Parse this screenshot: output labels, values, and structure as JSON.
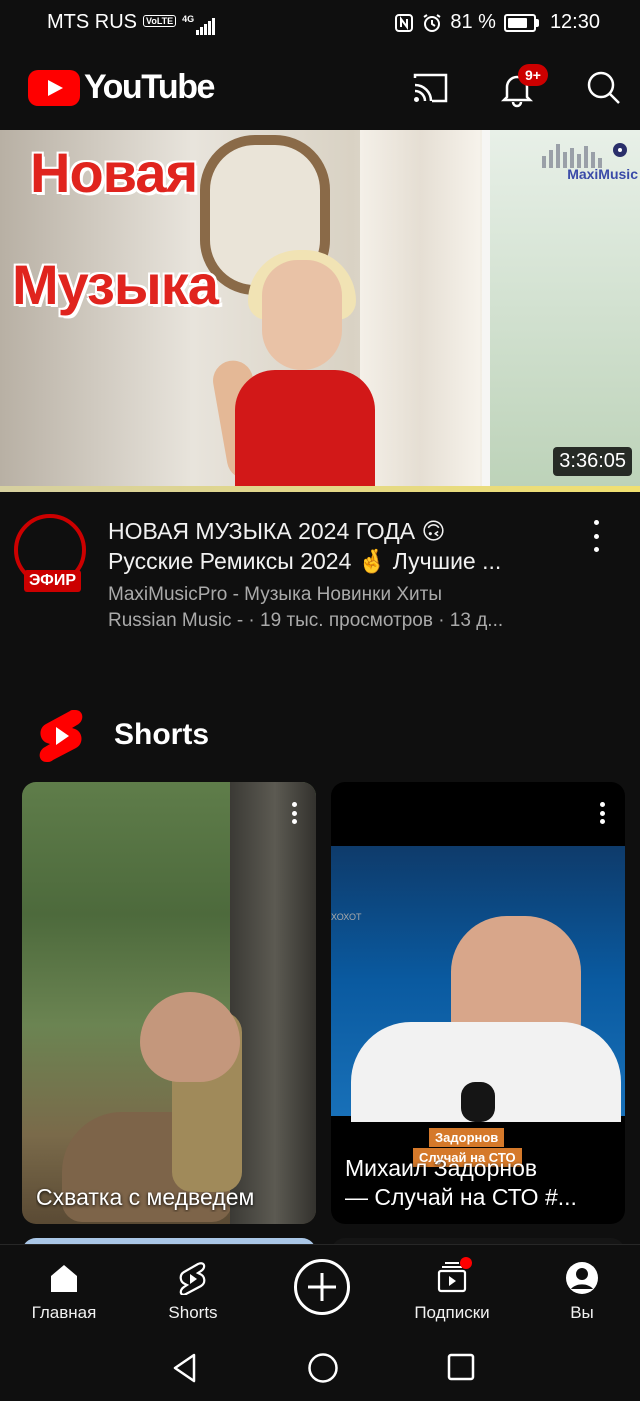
{
  "status_bar": {
    "carrier": "MTS RUS",
    "volte": "VoLTE",
    "network": "4G",
    "battery": "81 %",
    "time": "12:30"
  },
  "header": {
    "app_name": "YouTube",
    "notifications_badge": "9+"
  },
  "featured_video": {
    "thumbnail_title_line1": "Новая",
    "thumbnail_title_line2": "Музыка",
    "thumbnail_brand": "MaxiMusic",
    "duration": "3:36:05",
    "channel_badge": "ЭФИР",
    "title_line1": "НОВАЯ МУЗЫКА 2024 ГОДА 🙃",
    "title_line2": "Русские Ремиксы 2024 🤞 Лучшие ...",
    "meta_line1": "MaxiMusicPro - Музыка Новинки Хиты",
    "meta_line2": "Russian Music - · 19 тыс. просмотров · 13 д..."
  },
  "shorts": {
    "section_title": "Shorts",
    "items": [
      {
        "title_line1": "Схватка с медведем",
        "title_line2": ""
      },
      {
        "title_line1": "Михаил Задорнов",
        "title_line2": "— Случай на СТО #...",
        "overlay_label_1": "Задорнов",
        "overlay_label_2": "Случай на СТО",
        "corner_text": "ХОХОТ"
      }
    ]
  },
  "bottom_nav": {
    "home": "Главная",
    "shorts": "Shorts",
    "subscriptions": "Подписки",
    "you": "Вы"
  },
  "colors": {
    "background": "#0f0f0f",
    "brand_red": "#ff0000",
    "secondary_text": "#aaaaaa"
  }
}
